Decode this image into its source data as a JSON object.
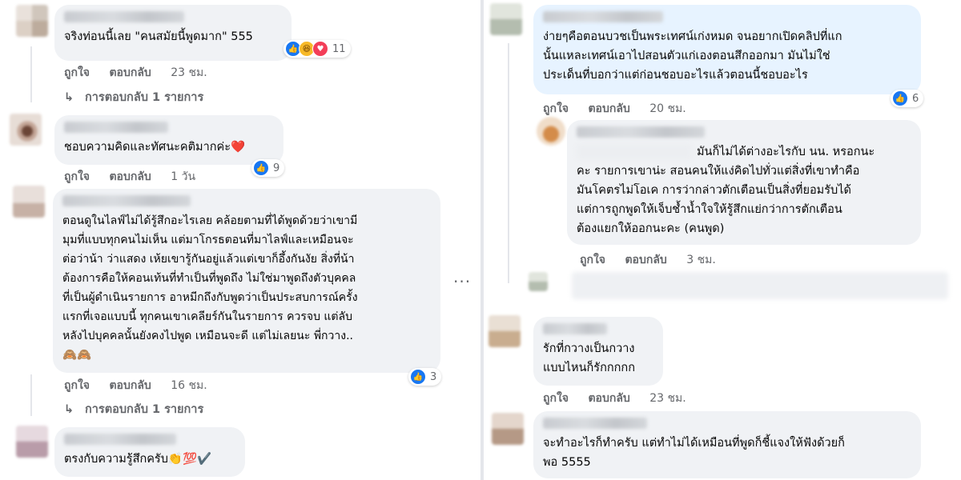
{
  "left": {
    "c1": {
      "text": "จริงท่อนนี้เลย \"คนสมัยนี้พูดมาก\" 555",
      "reactions": [
        "like",
        "haha",
        "love"
      ],
      "count": "11",
      "like": "ถูกใจ",
      "reply": "ตอบกลับ",
      "time": "23 ชม.",
      "replies_link": "การตอบกลับ 1 รายการ"
    },
    "c2": {
      "text": "ชอบความคิดและทัศนะคติมากค่ะ",
      "emoji": "❤️",
      "reactions": [
        "like"
      ],
      "count": "9",
      "like": "ถูกใจ",
      "reply": "ตอบกลับ",
      "time": "1 วัน"
    },
    "c3": {
      "text": "ตอนดูในไลฟ์ไม่ได้รู้สึกอะไรเลย คล้อยตามที่ได้พูดด้วยว่าเขามี\nมุมที่แบบทุกคนไม่เห็น แต่มาโกรธตอนที่มาไลฟ์และเหมือนจะ\nต่อว่าน้า ว่าแสดง เห้ยเขารู้กันอยู่แล้วแต่เขาก็อึ้งกันงัย สิ่งที่น้า\nต้องการคือให้คอนเท้นที่ทำเป็นที่พูดถึง ไม่ใช่มาพูดถึงตัวบุคคล\nที่เป็นผู้ดำเนินรายการ อาหมีกถึงกับพูดว่าเป็นประสบการณ์ครั้ง\nแรกที่เจอแบบนี้ ทุกคนเขาเคลียร์กันในรายการ ควรจบ แต่ลับ\nหลังไปบุคคลนั้นยังคงไปพูด เหมือนจะดี แต่ไม่เลยนะ พี่กวาง..",
      "emoji": "🙈🙈",
      "reactions": [
        "like"
      ],
      "count": "3",
      "like": "ถูกใจ",
      "reply": "ตอบกลับ",
      "time": "16 ชม.",
      "replies_link": "การตอบกลับ 1 รายการ",
      "more": "···"
    },
    "c4": {
      "text": "ตรงกับความรู้สึกครับ",
      "emoji": "👏💯✔️"
    }
  },
  "right": {
    "c1": {
      "text": "ง่ายๆคือตอนบวชเป็นพระเทศน์เก่งหมด จนอยากเปิดคลิปที่แก\nนั้นแหละเทศน์เอาไปสอนตัวแก่เองตอนสึกออกมา มันไม่ใช่\nประเด็นที่บอกว่าแต่ก่อนชอบอะไรแล้วตอนนี้ชอบอะไร",
      "reactions": [
        "like"
      ],
      "count": "6",
      "like": "ถูกใจ",
      "reply": "ตอบกลับ",
      "time": "20 ชม."
    },
    "c2": {
      "text": "มันก็ไม่ได้ต่างอะไรกับ นน. หรอกนะ\nคะ รายการเขาน่ะ สอนคนให้แง่คิดไปทั่วแต่สิ่งที่เขาทำคือ\nมันโคตรไม่โอเค การว่ากล่าวตักเตือนเป็นสิ่งที่ยอมรับได้\nแต่การถูกพูดให้เจ็บช้ำน้ำใจให้รู้สึกแย่กว่าการตักเตือน\nต้องแยกให้ออกนะคะ (คนพูด)",
      "like": "ถูกใจ",
      "reply": "ตอบกลับ",
      "time": "3 ชม."
    },
    "c3": {
      "text": "รักที่กวางเป็นกวาง\nแบบไหนก็รักกกกก",
      "like": "ถูกใจ",
      "reply": "ตอบกลับ",
      "time": "23 ชม."
    },
    "c4": {
      "text": "จะทำอะไรก็ทำครับ แต่ทำไม่ได้เหมือนที่พูดก็ชี้แจงให้ฟังด้วยก็\nพอ 5555"
    }
  }
}
